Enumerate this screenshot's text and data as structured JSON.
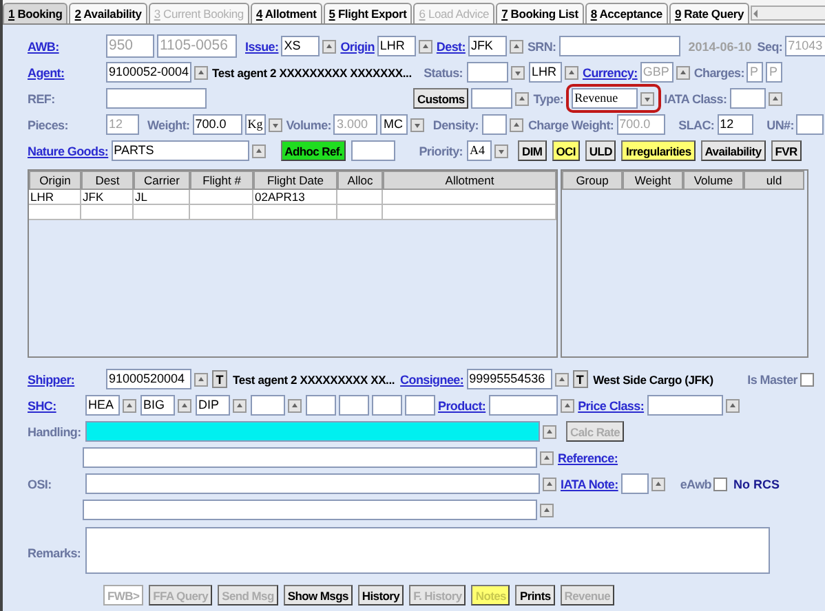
{
  "tabs": [
    {
      "number": "1",
      "label": "Booking",
      "selected": true,
      "disabled": false
    },
    {
      "number": "2",
      "label": "Availability",
      "selected": false,
      "disabled": false
    },
    {
      "number": "3",
      "label": "Current Booking",
      "selected": false,
      "disabled": true
    },
    {
      "number": "4",
      "label": "Allotment",
      "selected": false,
      "disabled": false
    },
    {
      "number": "5",
      "label": "Flight Export",
      "selected": false,
      "disabled": false
    },
    {
      "number": "6",
      "label": "Load Advice",
      "selected": false,
      "disabled": true
    },
    {
      "number": "7",
      "label": "Booking List",
      "selected": false,
      "disabled": false
    },
    {
      "number": "8",
      "label": "Acceptance",
      "selected": false,
      "disabled": false
    },
    {
      "number": "9",
      "label": "Rate Query",
      "selected": false,
      "disabled": false
    }
  ],
  "form": {
    "awb": {
      "label": "AWB:",
      "prefix": "950",
      "number": "1105-0056",
      "disabled": true
    },
    "issue": {
      "label": "Issue:",
      "value": "XS"
    },
    "origin": {
      "label": "Origin",
      "value": "LHR"
    },
    "dest": {
      "label": "Dest:",
      "value": "JFK"
    },
    "srn": {
      "label": "SRN:"
    },
    "date": "2014-06-10",
    "seq": {
      "label": "Seq:",
      "value": "71043",
      "disabled": true
    },
    "agent": {
      "label": "Agent:",
      "code": "9100052-0004",
      "name": "Test agent 2 XXXXXXXXX XXXXXXX..."
    },
    "status": {
      "label": "Status:",
      "station": "LHR"
    },
    "currency": {
      "label": "Currency:",
      "value": "GBP",
      "disabled": true
    },
    "charges": {
      "label": "Charges:",
      "values": [
        "P",
        "P"
      ],
      "disabled": true
    },
    "ref": {
      "label": "REF:"
    },
    "customs_button": "Customs",
    "type": {
      "label": "Type:",
      "value": "Revenue"
    },
    "iata_class": {
      "label": "IATA Class:"
    },
    "pieces": {
      "label": "Pieces:",
      "value": "12",
      "disabled": true
    },
    "weight": {
      "label": "Weight:",
      "value": "700.0",
      "unit": "Kg"
    },
    "volume": {
      "label": "Volume:",
      "value": "3.000",
      "unit": "MC",
      "disabled": true
    },
    "density": {
      "label": "Density:"
    },
    "charge_weight": {
      "label": "Charge Weight:",
      "value": "700.0",
      "disabled": true
    },
    "slac": {
      "label": "SLAC:",
      "value": "12"
    },
    "un": {
      "label": "UN#:"
    },
    "nature_goods": {
      "label": "Nature Goods:",
      "value": "PARTS"
    },
    "adhoc_button": "Adhoc Ref.",
    "priority": {
      "label": "Priority:",
      "value": "A4"
    },
    "action_buttons": [
      {
        "label": "DIM",
        "highlighted": false
      },
      {
        "label": "OCI",
        "highlighted": true
      },
      {
        "label": "ULD",
        "highlighted": false
      },
      {
        "label": "Irregularities",
        "highlighted": true
      },
      {
        "label": "Availability",
        "highlighted": false
      },
      {
        "label": "FVR",
        "highlighted": false
      }
    ]
  },
  "flights_table": {
    "columns": [
      "Origin",
      "Dest",
      "Carrier",
      "Flight #",
      "Flight Date",
      "Alloc",
      "Allotment"
    ],
    "rows": [
      {
        "cells": [
          "LHR",
          "JFK",
          "JL",
          null,
          "02APR13",
          null,
          null
        ]
      }
    ]
  },
  "uld_table": {
    "columns": [
      "Group",
      "Weight",
      "Volume",
      "uld"
    ]
  },
  "parties": {
    "shipper": {
      "label": "Shipper:",
      "code": "91000520004",
      "type_button": "T",
      "name": "Test agent 2 XXXXXXXXX XX..."
    },
    "consignee": {
      "label": "Consignee:",
      "code": "99995554536",
      "type_button": "T",
      "name": "West Side Cargo (JFK)"
    },
    "is_master": {
      "label": "Is Master",
      "checked": false
    }
  },
  "shc": {
    "label": "SHC:",
    "codes": [
      "HEA",
      "BIG",
      "DIP"
    ]
  },
  "product": {
    "label": "Product:"
  },
  "price_class": {
    "label": "Price Class:"
  },
  "handling": {
    "label": "Handling:"
  },
  "calc_rate_button": {
    "label": "Calc Rate",
    "disabled": true
  },
  "reference": {
    "label": "Reference:"
  },
  "osi": {
    "label": "OSI:"
  },
  "iata_note": {
    "label": "IATA Note:"
  },
  "eawb": {
    "label": "eAwb",
    "checked": false
  },
  "no_rcs": "No RCS",
  "remarks": {
    "label": "Remarks:"
  },
  "bottom_buttons": [
    {
      "label": "FWB>",
      "disabled": true,
      "highlighted": false
    },
    {
      "label": "FFA Query",
      "disabled": true,
      "highlighted": false
    },
    {
      "label": "Send Msg",
      "disabled": true,
      "highlighted": false
    },
    {
      "label": "Show Msgs",
      "disabled": false,
      "highlighted": false
    },
    {
      "label": "History",
      "disabled": false,
      "highlighted": false
    },
    {
      "label": "F. History",
      "disabled": true,
      "highlighted": false
    },
    {
      "label": "Notes",
      "disabled": true,
      "highlighted": true
    },
    {
      "label": "Prints",
      "disabled": false,
      "highlighted": false
    },
    {
      "label": "Revenue",
      "disabled": true,
      "highlighted": false
    }
  ]
}
